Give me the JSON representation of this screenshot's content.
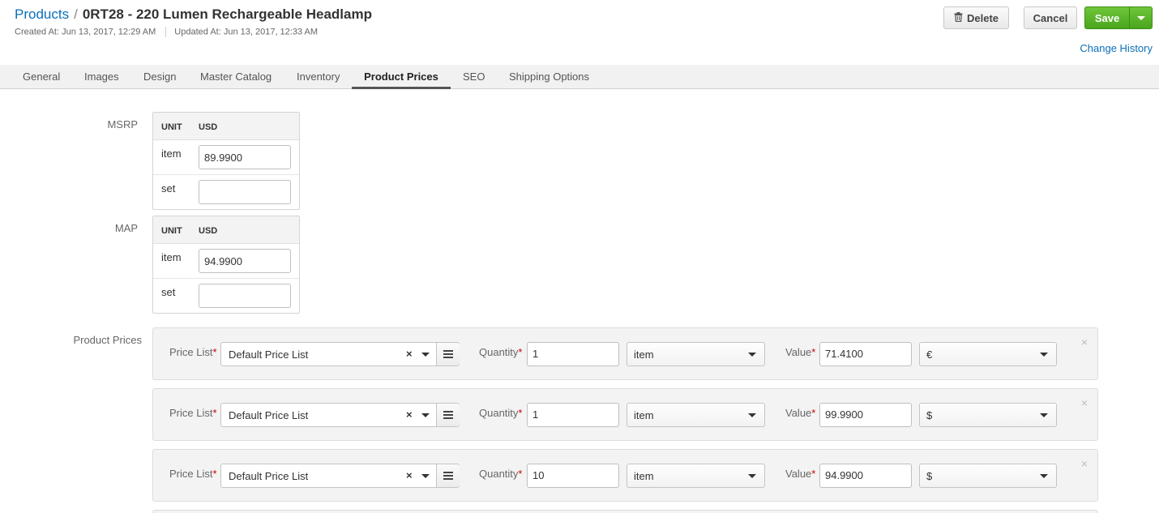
{
  "header": {
    "breadcrumb_link": "Products",
    "separator": "/",
    "title": "0RT28 - 220 Lumen Rechargeable Headlamp",
    "created": "Created At: Jun 13, 2017, 12:29 AM",
    "updated": "Updated At: Jun 13, 2017, 12:33 AM",
    "delete_label": "Delete",
    "cancel_label": "Cancel",
    "save_label": "Save",
    "change_history_label": "Change History"
  },
  "tabs": [
    {
      "label": "General"
    },
    {
      "label": "Images"
    },
    {
      "label": "Design"
    },
    {
      "label": "Master Catalog"
    },
    {
      "label": "Inventory"
    },
    {
      "label": "Product Prices",
      "active": true
    },
    {
      "label": "SEO"
    },
    {
      "label": "Shipping Options"
    }
  ],
  "msrp": {
    "label": "MSRP",
    "col_unit": "UNIT",
    "col_currency": "USD",
    "rows": [
      {
        "unit": "item",
        "value": "89.9900"
      },
      {
        "unit": "set",
        "value": ""
      }
    ]
  },
  "map": {
    "label": "MAP",
    "col_unit": "UNIT",
    "col_currency": "USD",
    "rows": [
      {
        "unit": "item",
        "value": "94.9900"
      },
      {
        "unit": "set",
        "value": ""
      }
    ]
  },
  "product_prices": {
    "label": "Product Prices",
    "price_list_label": "Price List",
    "quantity_label": "Quantity",
    "value_label": "Value",
    "required_mark": "*",
    "clear_glyph": "×",
    "remove_glyph": "×",
    "rows": [
      {
        "price_list": "Default Price List",
        "quantity": "1",
        "unit": "item",
        "value": "71.4100",
        "currency": "€"
      },
      {
        "price_list": "Default Price List",
        "quantity": "1",
        "unit": "item",
        "value": "99.9900",
        "currency": "$"
      },
      {
        "price_list": "Default Price List",
        "quantity": "10",
        "unit": "item",
        "value": "94.9900",
        "currency": "$"
      }
    ]
  }
}
